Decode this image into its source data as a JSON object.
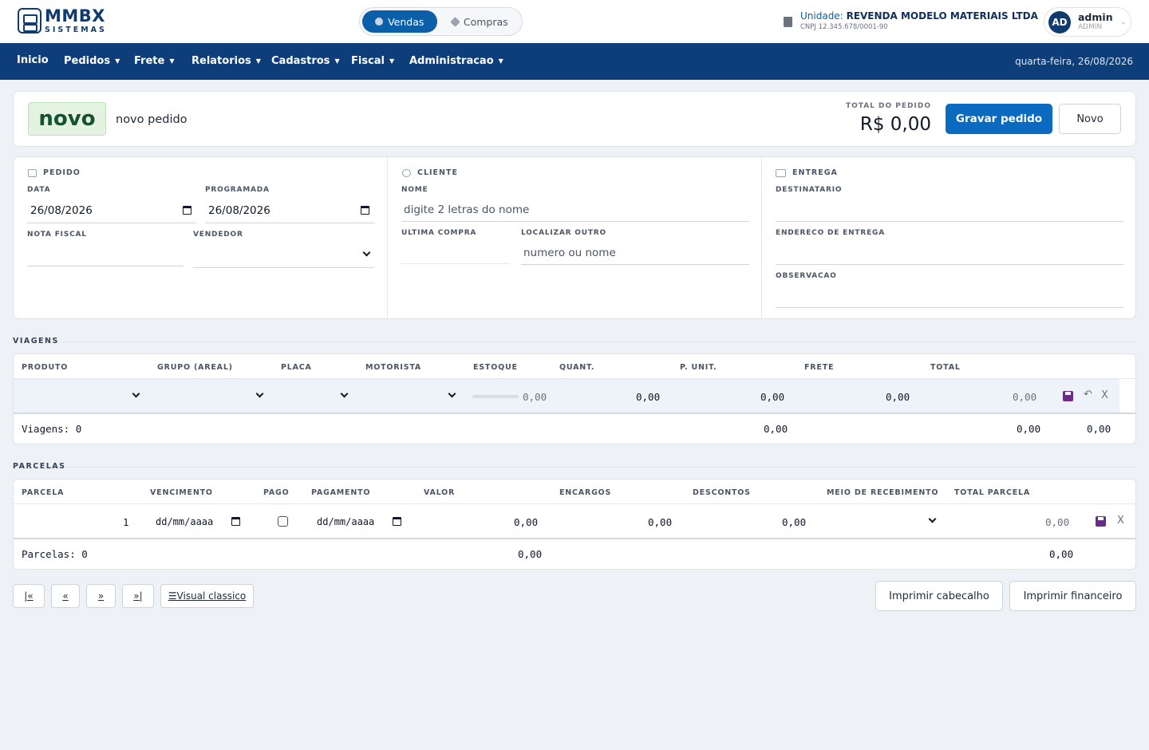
{
  "brand": {
    "line1": "MMBX",
    "line2": "SISTEMAS"
  },
  "mode_switch": {
    "active": "Vendas",
    "inactive": "Compras"
  },
  "unit": {
    "label": "Unidade:",
    "name": "REVENDA MODELO MATERIAIS LTDA",
    "cnpj": "CNPJ 12.345.678/0001-90"
  },
  "user": {
    "initials": "AD",
    "name": "admin",
    "role": "ADMIN"
  },
  "nav": {
    "items": [
      "Inicio",
      "Pedidos",
      "Frete",
      "Relatorios",
      "Cadastros",
      "Fiscal",
      "Administracao"
    ],
    "date": "quarta-feira, 26/08/2026"
  },
  "header": {
    "badge": "novo",
    "subtitle": "novo pedido",
    "total_label": "TOTAL DO PEDIDO",
    "total_value": "R$ 0,00",
    "save_label": "Gravar pedido",
    "new_label": "Novo"
  },
  "pedido": {
    "title": "PEDIDO",
    "data_label": "DATA",
    "data_value": "26/08/2026",
    "programada_label": "PROGRAMADA",
    "programada_value": "26/08/2026",
    "nota_label": "NOTA FISCAL",
    "vendedor_label": "VENDEDOR"
  },
  "cliente": {
    "title": "CLIENTE",
    "nome_label": "NOME",
    "nome_placeholder": "digite 2 letras do nome",
    "ultima_label": "ULTIMA COMPRA",
    "localizar_label": "LOCALIZAR OUTRO",
    "localizar_placeholder": "numero ou nome"
  },
  "entrega": {
    "title": "ENTREGA",
    "destinatario_label": "DESTINATARIO",
    "endereco_label": "ENDERECO DE ENTREGA",
    "observacao_label": "OBSERVACAO"
  },
  "viagens": {
    "section": "VIAGENS",
    "headers": [
      "PRODUTO",
      "GRUPO (AREAL)",
      "PLACA",
      "MOTORISTA",
      "ESTOQUE",
      "QUANT.",
      "P. UNIT.",
      "FRETE",
      "TOTAL"
    ],
    "row": {
      "estoque": "0,00",
      "quant": "0,00",
      "punit": "0,00",
      "frete": "0,00",
      "total": "0,00",
      "undo": "↶",
      "delete": "X"
    },
    "footer": {
      "count": "Viagens: 0",
      "sum1": "0,00",
      "sum2": "0,00",
      "sum3": "0,00"
    }
  },
  "parcelas": {
    "section": "PARCELAS",
    "headers": [
      "PARCELA",
      "VENCIMENTO",
      "PAGO",
      "PAGAMENTO",
      "VALOR",
      "ENCARGOS",
      "DESCONTOS",
      "MEIO DE RECEBIMENTO",
      "TOTAL PARCELA"
    ],
    "row": {
      "parcela": "1",
      "vencimento": "dd/mm/aaaa",
      "pagamento": "dd/mm/aaaa",
      "valor": "0,00",
      "encargos": "0,00",
      "descontos": "0,00",
      "total": "0,00",
      "delete": "X"
    },
    "footer": {
      "count": "Parcelas: 0",
      "sum1": "0,00",
      "sum2": "0,00"
    }
  },
  "footer_nav": {
    "first": "|«",
    "prev": "«",
    "next": "»",
    "last": "»|",
    "classic": "☰Visual classico",
    "print_header": "Imprimir cabecalho",
    "print_fin": "Imprimir financeiro"
  }
}
